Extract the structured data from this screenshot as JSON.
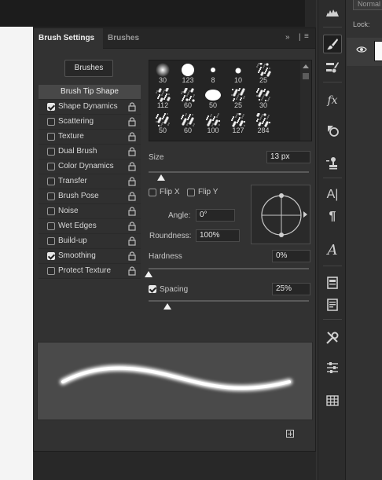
{
  "panel": {
    "tab_active": "Brush Settings",
    "tab_inactive": "Brushes",
    "brushes_button": "Brushes",
    "options_header": "Brush Tip Shape",
    "options": [
      {
        "label": "Shape Dynamics",
        "checked": true
      },
      {
        "label": "Scattering",
        "checked": false
      },
      {
        "label": "Texture",
        "checked": false
      },
      {
        "label": "Dual Brush",
        "checked": false
      },
      {
        "label": "Color Dynamics",
        "checked": false
      },
      {
        "label": "Transfer",
        "checked": false
      },
      {
        "label": "Brush Pose",
        "checked": false
      },
      {
        "label": "Noise",
        "checked": false
      },
      {
        "label": "Wet Edges",
        "checked": false
      },
      {
        "label": "Build-up",
        "checked": false
      },
      {
        "label": "Smoothing",
        "checked": true
      },
      {
        "label": "Protect Texture",
        "checked": false
      }
    ],
    "presets": [
      "30",
      "123",
      "8",
      "10",
      "25",
      "112",
      "60",
      "50",
      "25",
      "30",
      "50",
      "60",
      "100",
      "127",
      "284"
    ],
    "size": {
      "label": "Size",
      "value": "13 px",
      "level_pct": 8
    },
    "flip_x": {
      "label": "Flip X",
      "checked": false
    },
    "flip_y": {
      "label": "Flip Y",
      "checked": false
    },
    "angle": {
      "label": "Angle:",
      "value": "0°"
    },
    "roundness": {
      "label": "Roundness:",
      "value": "100%"
    },
    "hardness": {
      "label": "Hardness",
      "value": "0%",
      "level_pct": 0
    },
    "spacing": {
      "label": "Spacing",
      "value": "25%",
      "checked": true,
      "level_pct": 12
    }
  },
  "layers": {
    "blend_mode": "Normal",
    "lock_label": "Lock:"
  },
  "toolbar": {
    "icons": [
      "histogram-icon",
      "brush-icon",
      "brush-presets-icon",
      "fx-icon",
      "shapes-icon",
      "clone-stamp-icon",
      "character-icon",
      "paragraph-icon",
      "glyphs-icon",
      "notes-icon",
      "document-icon",
      "tools-icon",
      "adjustments-icon",
      "table-icon"
    ]
  }
}
